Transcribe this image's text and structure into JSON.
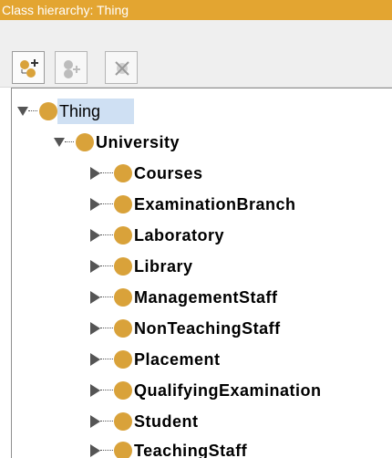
{
  "panel": {
    "title": "Class hierarchy: Thing"
  },
  "toolbar": {
    "buttons": [
      {
        "icon": "add-subclass-icon",
        "enabled": true
      },
      {
        "icon": "add-sibling-class-icon",
        "enabled": false
      },
      {
        "icon": "delete-class-icon",
        "enabled": false
      }
    ]
  },
  "tree": {
    "root": {
      "label": "Thing",
      "expanded": true,
      "selected": true
    },
    "university": {
      "label": "University",
      "expanded": true
    },
    "children": [
      {
        "label": "Courses"
      },
      {
        "label": "ExaminationBranch"
      },
      {
        "label": "Laboratory"
      },
      {
        "label": "Library"
      },
      {
        "label": "ManagementStaff"
      },
      {
        "label": "NonTeachingStaff"
      },
      {
        "label": "Placement"
      },
      {
        "label": "QualifyingExamination"
      },
      {
        "label": "Student"
      },
      {
        "label": "TeachingStaff"
      }
    ]
  },
  "colors": {
    "title_bar": "#e3a531",
    "class_dot": "#d9a23a",
    "selection": "#cfe0f3"
  }
}
